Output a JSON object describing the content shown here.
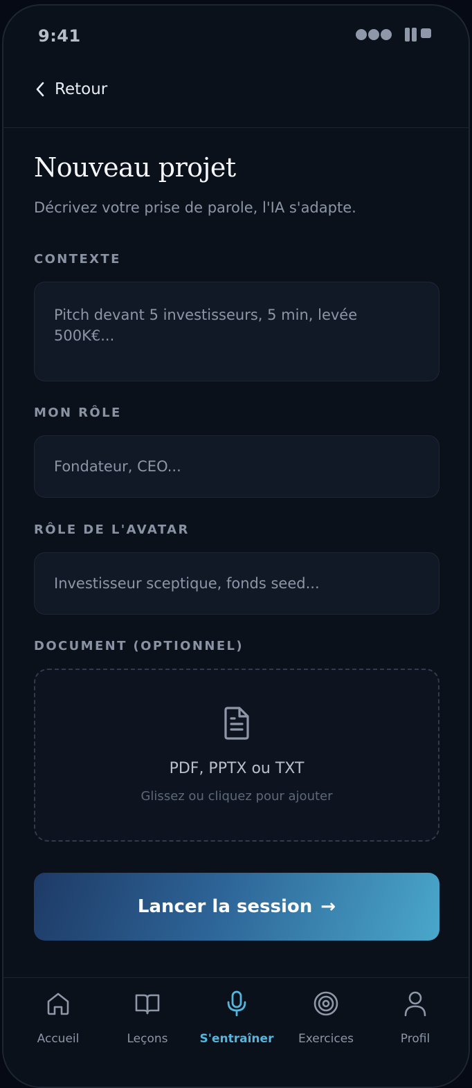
{
  "status_bar": {
    "time": "9:41"
  },
  "header": {
    "back_label": "Retour"
  },
  "page": {
    "title": "Nouveau projet",
    "subtitle": "Décrivez votre prise de parole, l'IA s'adapte."
  },
  "form": {
    "context": {
      "label": "CONTEXTE",
      "placeholder": "Pitch devant 5 investisseurs, 5 min, levée 500K€...",
      "value": ""
    },
    "my_role": {
      "label": "MON RÔLE",
      "placeholder": "Fondateur, CEO...",
      "value": ""
    },
    "avatar_role": {
      "label": "RÔLE DE L'AVATAR",
      "placeholder": "Investisseur sceptique, fonds seed...",
      "value": ""
    },
    "document": {
      "label": "DOCUMENT (OPTIONNEL)",
      "formats": "PDF, PPTX ou TXT",
      "hint": "Glissez ou cliquez pour ajouter",
      "icon": "file-text-icon"
    }
  },
  "launch": {
    "label": "Lancer la session",
    "arrow": "→"
  },
  "tabs": [
    {
      "label": "Accueil",
      "icon": "home-icon",
      "active": false
    },
    {
      "label": "Leçons",
      "icon": "book-icon",
      "active": false
    },
    {
      "label": "S'entraîner",
      "icon": "microphone-icon",
      "active": true
    },
    {
      "label": "Exercices",
      "icon": "target-icon",
      "active": false
    },
    {
      "label": "Profil",
      "icon": "user-icon",
      "active": false
    }
  ],
  "colors": {
    "background": "#0b111b",
    "field": "#111826",
    "accent": "#52b6df",
    "button_start": "#1e3a66",
    "button_end": "#4aa7cb"
  }
}
